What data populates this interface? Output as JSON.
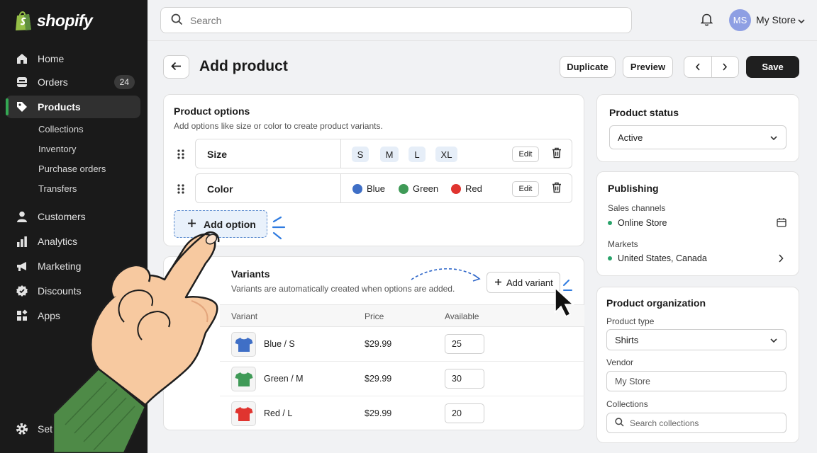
{
  "brand": {
    "name": "shopify"
  },
  "sidebar": {
    "items": [
      {
        "label": "Home",
        "icon": "home-icon"
      },
      {
        "label": "Orders",
        "icon": "orders-icon",
        "badge": "24"
      },
      {
        "label": "Products",
        "icon": "tag-icon",
        "active": true
      },
      {
        "label": "Customers",
        "icon": "person-icon"
      },
      {
        "label": "Analytics",
        "icon": "bar-chart-icon"
      },
      {
        "label": "Marketing",
        "icon": "megaphone-icon"
      },
      {
        "label": "Discounts",
        "icon": "discount-icon"
      },
      {
        "label": "Apps",
        "icon": "apps-icon"
      }
    ],
    "subitems": [
      "Collections",
      "Inventory",
      "Purchase orders",
      "Transfers"
    ],
    "settings": "Settings"
  },
  "topbar": {
    "search_placeholder": "Search",
    "avatar_initials": "MS",
    "store_name": "My Store"
  },
  "header": {
    "title": "Add product",
    "duplicate": "Duplicate",
    "preview": "Preview",
    "save": "Save"
  },
  "options": {
    "title": "Product options",
    "subtitle": "Add options like size or color to create product variants.",
    "size": {
      "name": "Size",
      "values": [
        "S",
        "M",
        "L",
        "XL"
      ]
    },
    "color": {
      "name": "Color",
      "values": [
        {
          "label": "Blue",
          "color": "#3f6fc6"
        },
        {
          "label": "Green",
          "color": "#3f9a57"
        },
        {
          "label": "Red",
          "color": "#e0342f"
        }
      ]
    },
    "edit": "Edit",
    "add_option": "Add option"
  },
  "variants": {
    "title": "Variants",
    "subtitle": "Variants are automatically created when options are added.",
    "add_variant": "Add variant",
    "columns": [
      "Variant",
      "Price",
      "Available"
    ],
    "rows": [
      {
        "name": "Blue / S",
        "price": "$29.99",
        "available": "25",
        "shirt_color": "#3f6fc6"
      },
      {
        "name": "Green / M",
        "price": "$29.99",
        "available": "30",
        "shirt_color": "#3f9a57"
      },
      {
        "name": "Red / L",
        "price": "$29.99",
        "available": "20",
        "shirt_color": "#e0342f"
      }
    ]
  },
  "status": {
    "title": "Product status",
    "value": "Active"
  },
  "publishing": {
    "title": "Publishing",
    "sales_label": "Sales channels",
    "sales_value": "Online Store",
    "markets_label": "Markets",
    "markets_value": "United States, Canada"
  },
  "organization": {
    "title": "Product organization",
    "type_label": "Product type",
    "type_value": "Shirts",
    "vendor_label": "Vendor",
    "vendor_value": "My Store",
    "collections_label": "Collections",
    "collections_placeholder": "Search collections"
  },
  "colors": {
    "accent_green": "#34a853",
    "sidebar_bg": "#1a1a1a",
    "highlight_blue": "#5d8ccf"
  }
}
